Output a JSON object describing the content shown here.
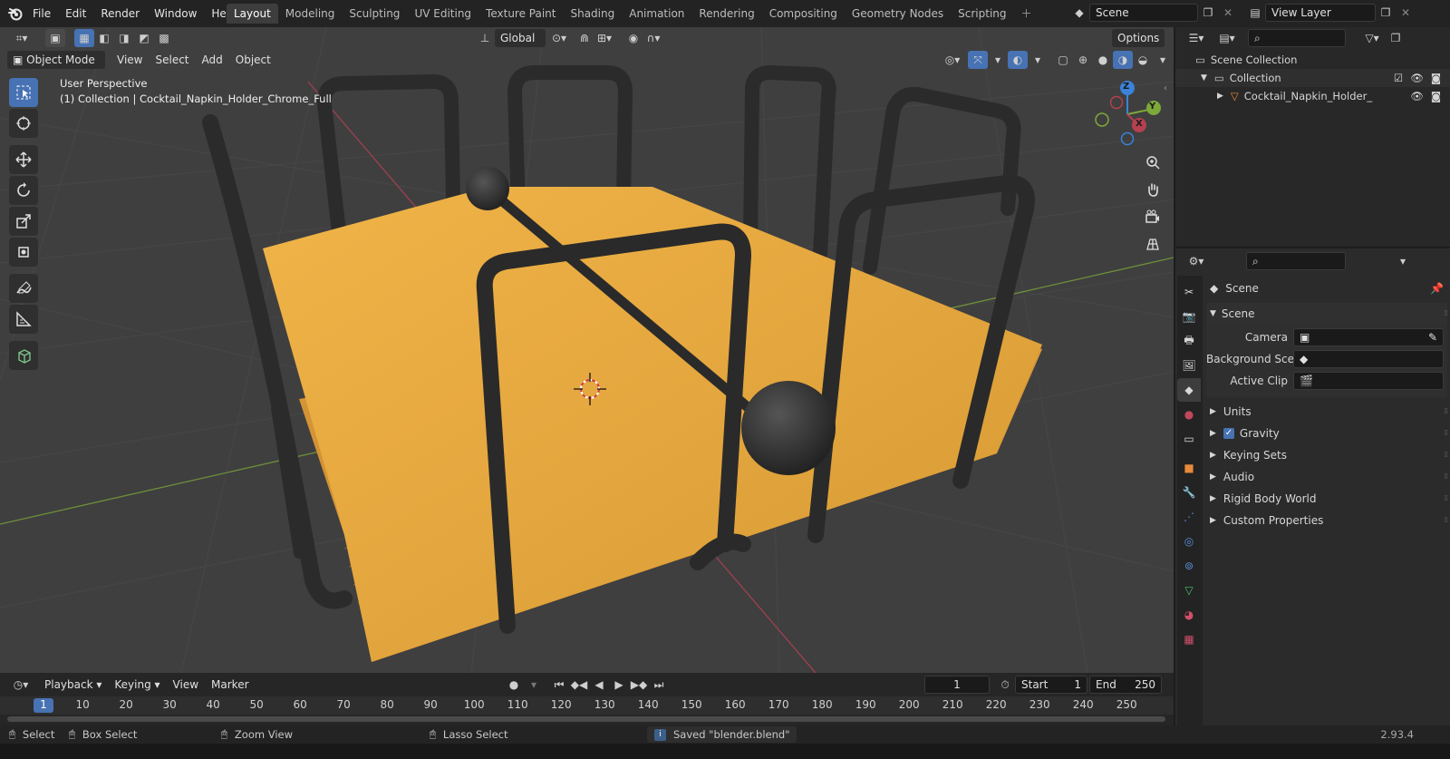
{
  "menubar": {
    "items": [
      "File",
      "Edit",
      "Render",
      "Window",
      "Help"
    ],
    "workspaces": [
      "Layout",
      "Modeling",
      "Sculpting",
      "UV Editing",
      "Texture Paint",
      "Shading",
      "Animation",
      "Rendering",
      "Compositing",
      "Geometry Nodes",
      "Scripting"
    ],
    "active_workspace": "Layout",
    "scene_name": "Scene",
    "view_layer": "View Layer"
  },
  "viewport": {
    "mode": "Object Mode",
    "menus": [
      "View",
      "Select",
      "Add",
      "Object"
    ],
    "transform_orientation": "Global",
    "options_label": "Options",
    "view_name": "User Perspective",
    "collection_info": "(1) Collection | Cocktail_Napkin_Holder_Chrome_Full",
    "gizmo_axes": {
      "x": "X",
      "y": "Y",
      "z": "Z"
    }
  },
  "timeline": {
    "menus": [
      "Playback",
      "Keying",
      "View",
      "Marker"
    ],
    "current_frame": "1",
    "start_label": "Start",
    "start_value": "1",
    "end_label": "End",
    "end_value": "250",
    "ruler": [
      "1",
      "10",
      "20",
      "30",
      "40",
      "50",
      "60",
      "70",
      "80",
      "90",
      "100",
      "110",
      "120",
      "130",
      "140",
      "150",
      "160",
      "170",
      "180",
      "190",
      "200",
      "210",
      "220",
      "230",
      "240",
      "250"
    ]
  },
  "statusbar": {
    "select": "Select",
    "box_select": "Box Select",
    "zoom_view": "Zoom View",
    "lasso_select": "Lasso Select",
    "message": "Saved \"blender.blend\"",
    "version": "2.93.4"
  },
  "outliner": {
    "root": "Scene Collection",
    "collection": "Collection",
    "object": "Cocktail_Napkin_Holder_"
  },
  "properties": {
    "context": "Scene",
    "panel_title": "Scene",
    "fields": [
      {
        "label": "Camera",
        "value": ""
      },
      {
        "label": "Background Sce...",
        "value": ""
      },
      {
        "label": "Active Clip",
        "value": ""
      }
    ],
    "subpanels": [
      "Units",
      "Gravity",
      "Keying Sets",
      "Audio",
      "Rigid Body World",
      "Custom Properties"
    ],
    "gravity_checked": true
  },
  "colors": {
    "accent": "#4772b3",
    "napkin": "#e3a63f",
    "metal": "#2e2e2e",
    "x_axis": "#b5404f",
    "y_axis": "#7ea83a",
    "z_axis": "#3b82d9"
  }
}
